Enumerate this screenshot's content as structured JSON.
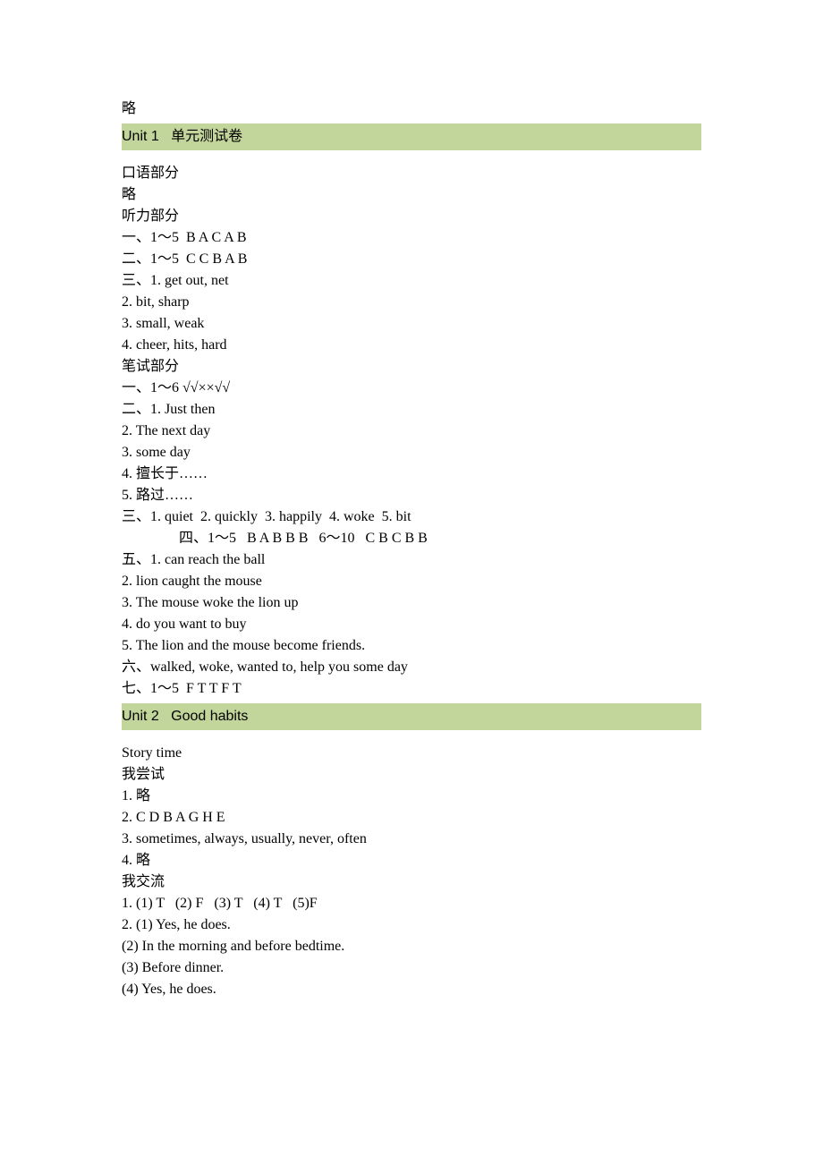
{
  "top_lines": [
    "略"
  ],
  "headings": [
    {
      "unit": "Unit 1   ",
      "title": "单元测试卷"
    },
    {
      "unit": "Unit 2   ",
      "title": "Good habits"
    }
  ],
  "block1": [
    "口语部分",
    "略",
    "听力部分",
    "一、1～5  B A C A B",
    "二、1～5  C C B A B",
    "三、1. get out, net",
    "2. bit, sharp",
    "3. small, weak",
    "4. cheer, hits, hard",
    "笔试部分",
    "一、1～6 √√××√√",
    "二、1. Just then",
    "2. The next day",
    "3. some day",
    "4. 擅长于……",
    "5. 路过……",
    "三、1. quiet  2. quickly  3. happily  4. woke  5. bit"
  ],
  "block1_indent": "四、1～5   B A B B B   6～10   C B C B B",
  "block1_after": [
    "五、1. can reach the ball",
    "2. lion caught the mouse",
    "3. The mouse woke the lion up",
    "4. do you want to buy",
    "5. The lion and the mouse become friends.",
    "六、walked, woke, wanted to, help you some day",
    "七、1～5  F T T F T"
  ],
  "block2": [
    "Story time",
    "我尝试",
    "1. 略",
    "2. C D B A G H E",
    "3. sometimes, always, usually, never, often",
    "4. 略",
    "我交流",
    "1. (1) T   (2) F   (3) T   (4) T   (5)F",
    "2. (1) Yes, he does.",
    "(2) In the morning and before bedtime.",
    "(3) Before dinner.",
    "(4) Yes, he does."
  ]
}
